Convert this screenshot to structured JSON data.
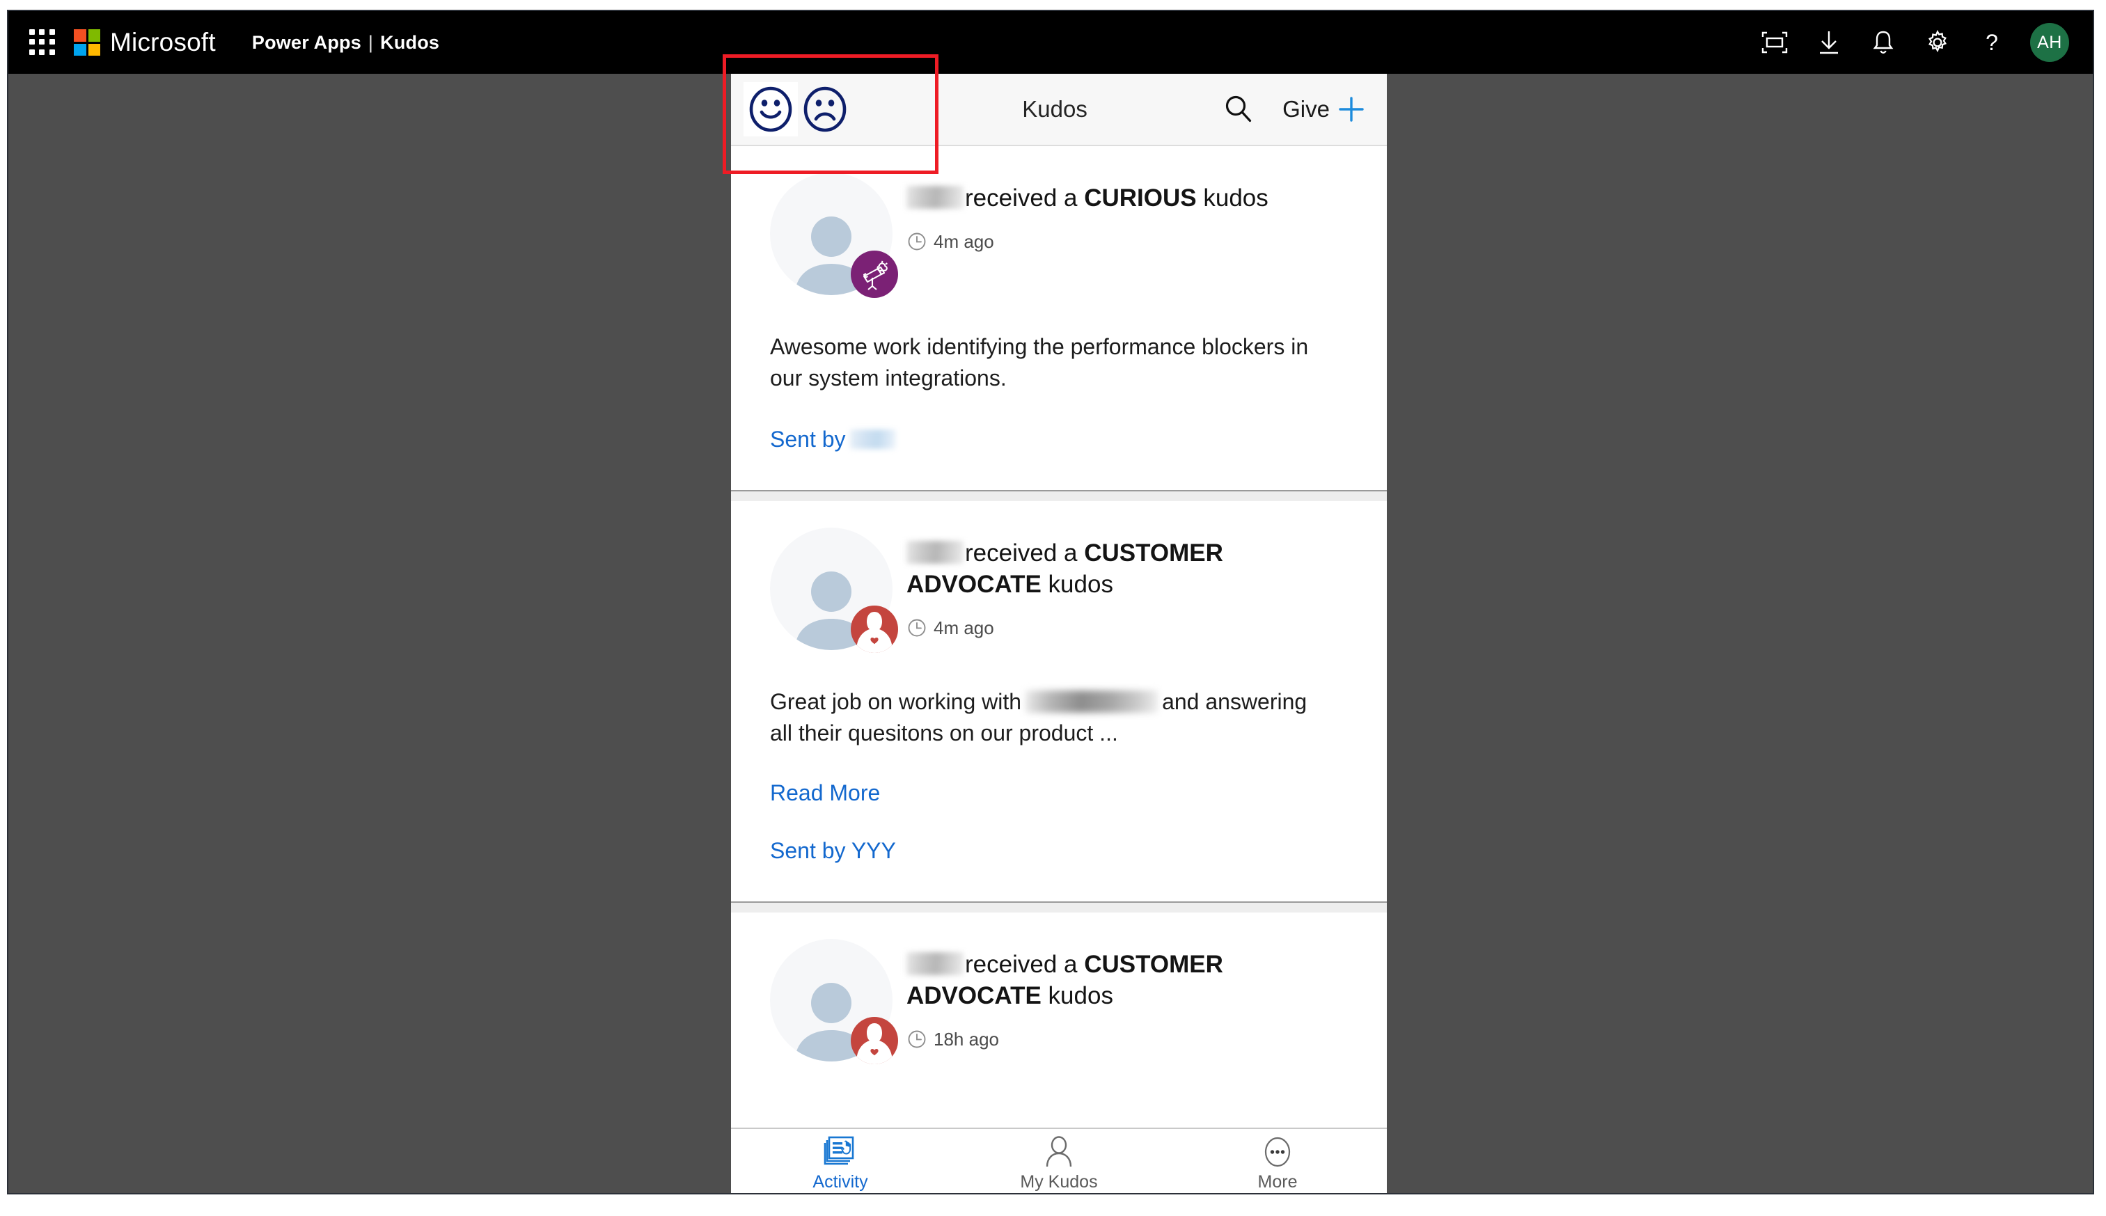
{
  "window": {
    "background_color": "#4e4e4e",
    "border_color": "#2b3038"
  },
  "header": {
    "waffle_label": "app-launcher",
    "brand": "Microsoft",
    "app_suite": "Power Apps",
    "separator": "|",
    "app_title": "Kudos",
    "icons": [
      {
        "name": "fullscreen-icon",
        "label": "Full screen"
      },
      {
        "name": "download-icon",
        "label": "Download"
      },
      {
        "name": "notifications-bell-icon",
        "label": "Notifications"
      },
      {
        "name": "settings-gear-icon",
        "label": "Settings"
      },
      {
        "name": "help-question-icon",
        "label": "Help"
      }
    ],
    "avatar": {
      "initials": "AH",
      "color": "#1d7145"
    }
  },
  "app_toolbar": {
    "happy_icon": "happy-face-icon",
    "sad_icon": "sad-face-icon",
    "title": "Kudos",
    "search_icon": "search-icon",
    "give_label": "Give",
    "give_plus_icon": "plus-icon",
    "accent_color": "#1d8bdc",
    "face_color": "#0e1f6b"
  },
  "annotation": {
    "type": "highlight-rectangle",
    "color": "#ee1c25",
    "targets": "happy-and-sad-face-icons"
  },
  "feed": {
    "cards": [
      {
        "recipient": "[blurred]",
        "received_prefix": "received a",
        "kudos_type": "CURIOUS",
        "kudos_suffix": "kudos",
        "timestamp": "4m ago",
        "badge": {
          "name": "telescope-badge-icon",
          "color": "#7b2175"
        },
        "message": "Awesome work identifying the performance blockers in our system integrations.",
        "read_more": null,
        "sent_by_label": "Sent by",
        "sent_by_name": "[blurred]"
      },
      {
        "recipient": "[blurred]",
        "received_prefix": "received a",
        "kudos_type": "CUSTOMER ADVOCATE",
        "kudos_suffix": "kudos",
        "timestamp": "4m ago",
        "badge": {
          "name": "customer-advocate-badge-icon",
          "color": "#c4453e"
        },
        "message_part1": "Great job on working with",
        "message_part2": "and answering all their quesitons on our product ...",
        "read_more": "Read More",
        "sent_by_label": "Sent by YYY",
        "sent_by_name": "YYY"
      },
      {
        "recipient": "[blurred]",
        "received_prefix": "received a",
        "kudos_type": "CUSTOMER ADVOCATE",
        "kudos_suffix": "kudos",
        "timestamp": "18h ago",
        "badge": {
          "name": "customer-advocate-badge-icon",
          "color": "#c4453e"
        }
      }
    ]
  },
  "bottom_nav": {
    "items": [
      {
        "label": "Activity",
        "icon": "activity-cards-hand-icon",
        "active": true
      },
      {
        "label": "My Kudos",
        "icon": "person-icon",
        "active": false
      },
      {
        "label": "More",
        "icon": "more-ellipsis-icon",
        "active": false
      }
    ],
    "active_color": "#1368ce",
    "inactive_color": "#5a5a5a"
  }
}
